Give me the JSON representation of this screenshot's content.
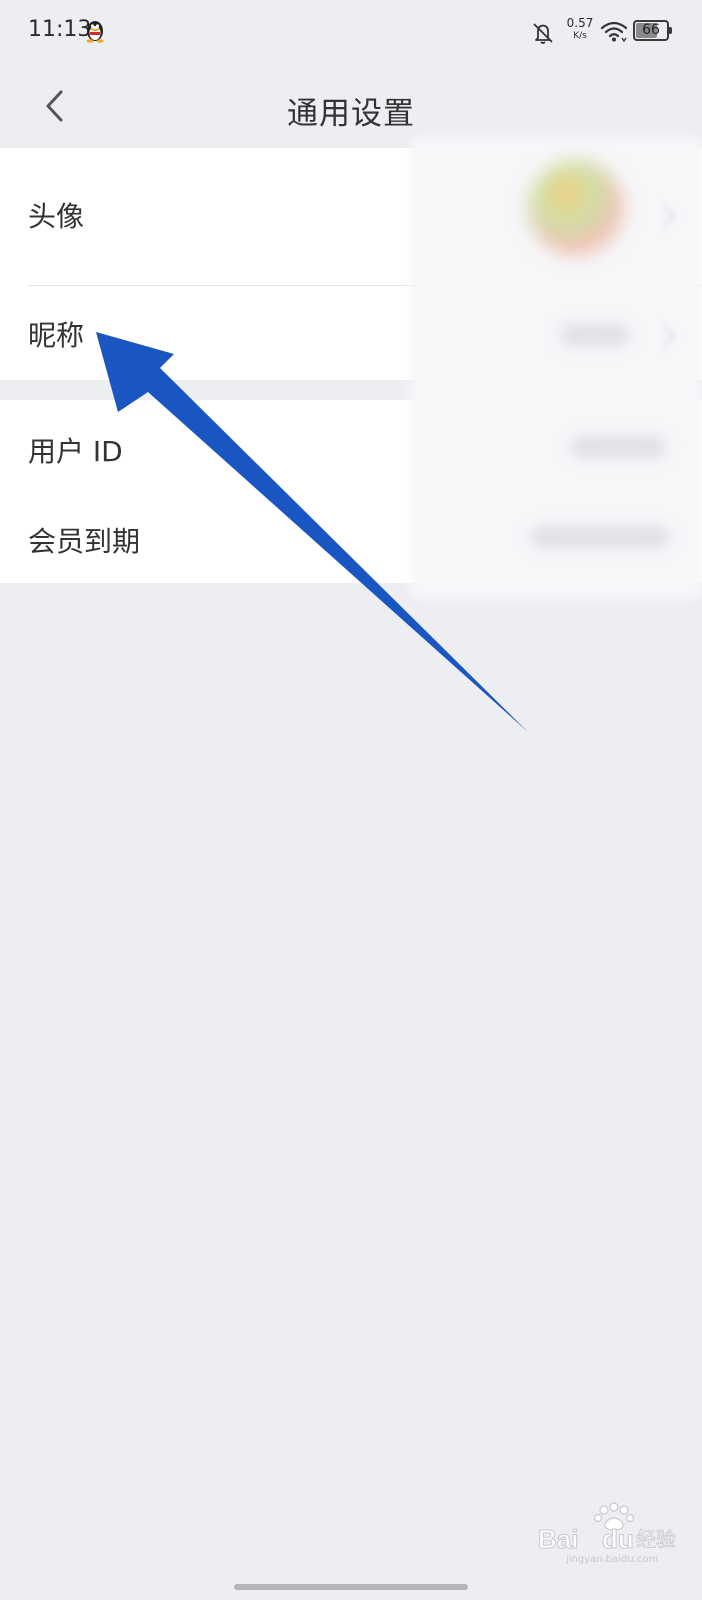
{
  "status_bar": {
    "time": "11:13",
    "network_speed_value": "0.57",
    "network_speed_unit": "K/s",
    "battery_level": "66",
    "icons": [
      "qq-icon",
      "bell-muted-icon",
      "wifi-icon",
      "battery-icon"
    ]
  },
  "header": {
    "title": "通用设置",
    "back_icon": "chevron-left-icon"
  },
  "settings": {
    "avatar_label": "头像",
    "nickname_label": "昵称",
    "user_id_label": "用户 ID",
    "membership_label": "会员到期"
  },
  "watermark": {
    "text": "Bai",
    "text2": "du",
    "cn": "经验",
    "url": "jingyan.baidu.com"
  },
  "colors": {
    "background": "#edeef2",
    "panel": "#ffffff",
    "arrow": "#1a56c2",
    "text": "#333333"
  }
}
